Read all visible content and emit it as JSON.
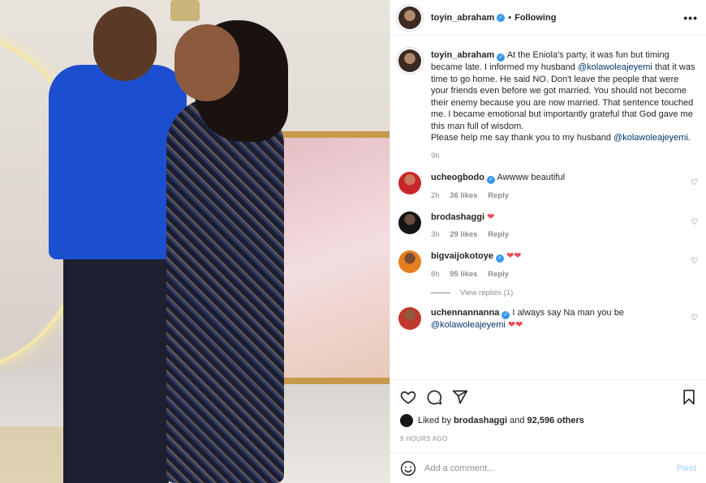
{
  "header": {
    "username": "toyin_abraham",
    "separator": "•",
    "following_label": "Following",
    "more_label": "•••"
  },
  "caption": {
    "username": "toyin_abraham",
    "text_1": "At the Eniola's party, it was fun but timing became late. I informed my husband",
    "mention_1": "@kolawoleajeyemi",
    "text_2": "that it was time to go home. He said NO. Don't leave the people that were your friends even before we got married. You should not become their enemy because you are now married. That sentence touched me. I became emotional but importantly grateful that God gave me this man full of wisdom.",
    "text_3": "Please help me say thank you to my husband",
    "mention_2": "@kolawoleajeyemi",
    "text_end": ".",
    "time": "9h"
  },
  "comments": [
    {
      "username": "ucheogbodo",
      "text": "Awwww beautiful",
      "time": "2h",
      "likes": "36 likes",
      "reply": "Reply"
    },
    {
      "username": "brodashaggi",
      "text": "",
      "hearts": "❤",
      "time": "3h",
      "likes": "29 likes",
      "reply": "Reply"
    },
    {
      "username": "bigvaijokotoye",
      "text": "",
      "hearts": "❤❤",
      "time": "8h",
      "likes": "95 likes",
      "reply": "Reply",
      "view_replies": "View replies (1)"
    },
    {
      "username": "uchennannanna",
      "text": "I always say Na man you be",
      "mention": "@kolawoleajeyemi",
      "hearts": "❤❤"
    }
  ],
  "actions": {
    "liked_by_prefix": "Liked by",
    "liked_by_user": "brodashaggi",
    "liked_by_and": "and",
    "liked_by_count": "92,596 others",
    "time_ago": "9 HOURS AGO"
  },
  "add_comment": {
    "placeholder": "Add a comment...",
    "post_label": "Post"
  },
  "colors": {
    "mention": "#00376b",
    "verified": "#3897f0",
    "heart": "#ed4956",
    "post_disabled": "#b2dffc"
  }
}
